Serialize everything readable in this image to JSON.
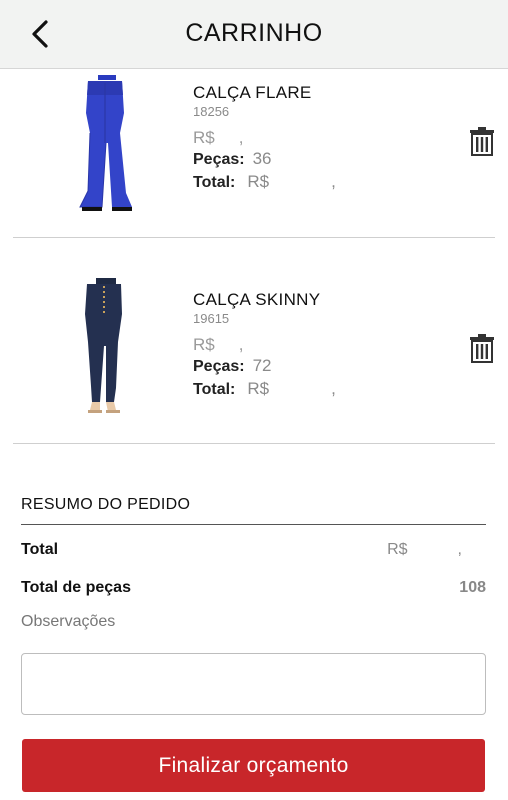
{
  "header": {
    "title": "CARRINHO",
    "back_icon": "chevron-left-icon"
  },
  "cart": {
    "items": [
      {
        "name": "CALÇA FLARE",
        "code": "18256",
        "price_currency": "R$",
        "price_sep": ",",
        "pieces_label": "Peças:",
        "pieces_value": "36",
        "total_label": "Total:",
        "total_currency": "R$",
        "total_sep": ",",
        "image": "flare-jeans-image",
        "remove_icon": "trash-icon"
      },
      {
        "name": "CALÇA SKINNY",
        "code": "19615",
        "price_currency": "R$",
        "price_sep": ",",
        "pieces_label": "Peças:",
        "pieces_value": "72",
        "total_label": "Total:",
        "total_currency": "R$",
        "total_sep": ",",
        "image": "skinny-jeans-image",
        "remove_icon": "trash-icon"
      }
    ]
  },
  "summary": {
    "title": "RESUMO DO PEDIDO",
    "total_label": "Total",
    "total_currency": "R$",
    "total_sep": ",",
    "pieces_label": "Total de peças",
    "pieces_value": "108",
    "notes_label": "Observações",
    "notes_value": ""
  },
  "actions": {
    "finalize_label": "Finalizar orçamento"
  },
  "colors": {
    "accent": "#c8262a",
    "header_bg": "#f2f3f2"
  }
}
